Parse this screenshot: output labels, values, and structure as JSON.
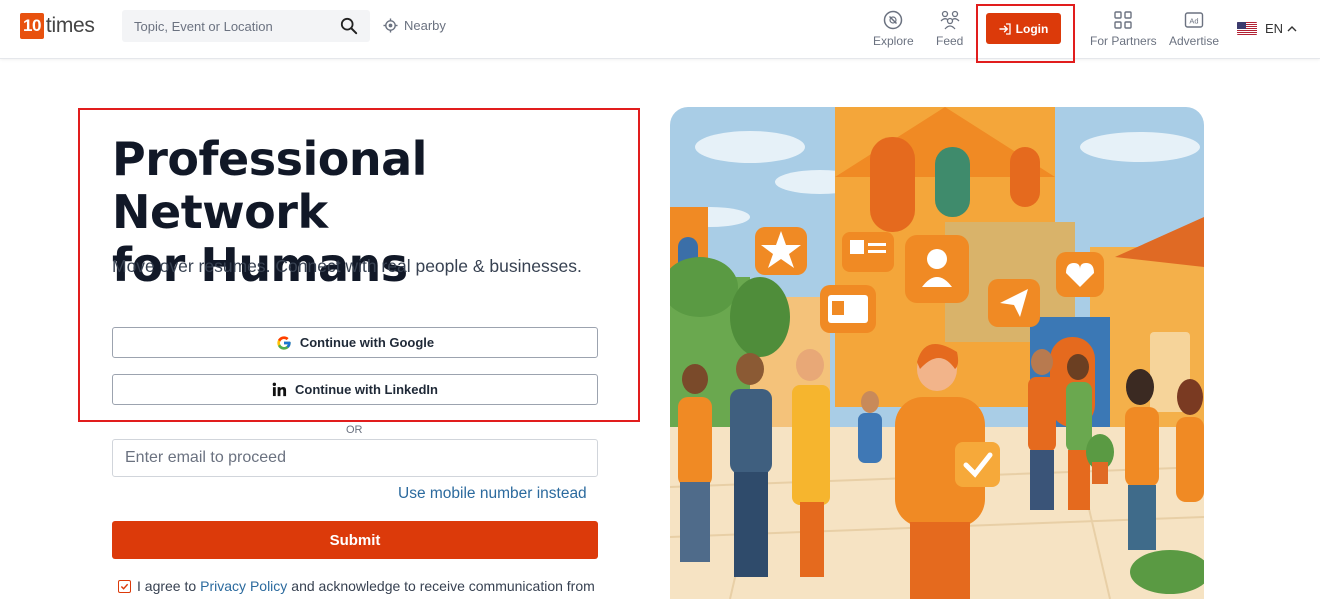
{
  "header": {
    "logo_number": "10",
    "logo_text": "times",
    "search_placeholder": "Topic, Event or Location",
    "nearby_label": "Nearby",
    "nav": {
      "explore": "Explore",
      "feed": "Feed",
      "login": "Login",
      "partners": "For Partners",
      "advertise": "Advertise",
      "language": "EN"
    }
  },
  "hero": {
    "title_line1": "Professional Network",
    "title_line2": "for Humans",
    "subtitle": "Move over resumes. Connect with real people & businesses."
  },
  "auth": {
    "google_label": "Continue with Google",
    "linkedin_label": "Continue with LinkedIn",
    "or_label": "OR",
    "email_placeholder": "Enter email to proceed",
    "mobile_link": "Use mobile number instead",
    "submit_label": "Submit",
    "agree_prefix": "I agree to",
    "privacy_link": "Privacy Policy",
    "agree_suffix": "and acknowledge to receive communication from"
  },
  "colors": {
    "brand": "#e8510e",
    "button": "#dc3a0a",
    "link": "#2b6a9e",
    "highlight": "#e11d1d"
  }
}
